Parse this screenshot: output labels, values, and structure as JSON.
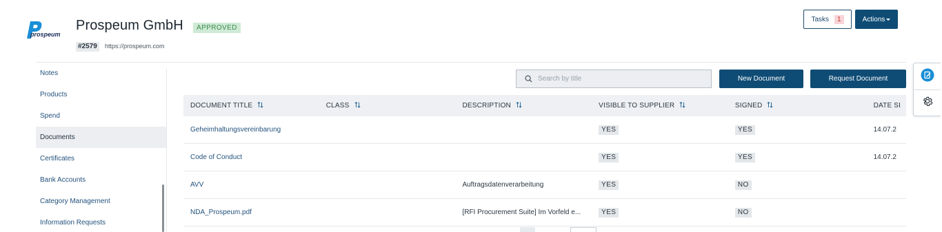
{
  "header": {
    "logo_text": "prospeum",
    "company_name": "Prospeum GmbH",
    "status": "APPROVED",
    "supplier_id": "#2579",
    "website": "https://prospeum.com",
    "tasks_label": "Tasks",
    "tasks_count": "1",
    "actions_label": "Actions"
  },
  "sidebar": {
    "items": [
      {
        "label": "Notes"
      },
      {
        "label": "Products"
      },
      {
        "label": "Spend"
      },
      {
        "label": "Documents"
      },
      {
        "label": "Certificates"
      },
      {
        "label": "Bank Accounts"
      },
      {
        "label": "Category Management"
      },
      {
        "label": "Information Requests"
      }
    ],
    "active_item": "Documents"
  },
  "toolbar": {
    "search_placeholder": "Search by title",
    "new_document_label": "New Document",
    "request_document_label": "Request Document"
  },
  "table": {
    "columns": [
      "DOCUMENT TITLE",
      "CLASS",
      "DESCRIPTION",
      "VISIBLE TO SUPPLIER",
      "SIGNED",
      "DATE SI"
    ],
    "rows": [
      {
        "title": "Geheimhaltungsvereinbarung",
        "class": "",
        "description": "",
        "visible": "YES",
        "signed": "YES",
        "date": "14.07.2"
      },
      {
        "title": "Code of Conduct",
        "class": "",
        "description": "",
        "visible": "YES",
        "signed": "YES",
        "date": "14.07.2"
      },
      {
        "title": "AVV",
        "class": "",
        "description": "Auftragsdatenverarbeitung",
        "visible": "YES",
        "signed": "NO",
        "date": ""
      },
      {
        "title": "NDA_Prospeum.pdf",
        "class": "",
        "description": "[RFI Procurement Suite] Im Vorfeld e...",
        "visible": "YES",
        "signed": "NO",
        "date": ""
      }
    ]
  },
  "colors": {
    "primary": "#0f4c75",
    "link": "#23527c",
    "approved_bg": "#cfead6",
    "approved_text": "#3d8c4f",
    "logo_blue": "#1a8fd6"
  },
  "icons": {
    "search": "search-icon",
    "sort": "sort-icon",
    "notes_float": "note-edit-icon",
    "settings_float": "gear-icon"
  }
}
